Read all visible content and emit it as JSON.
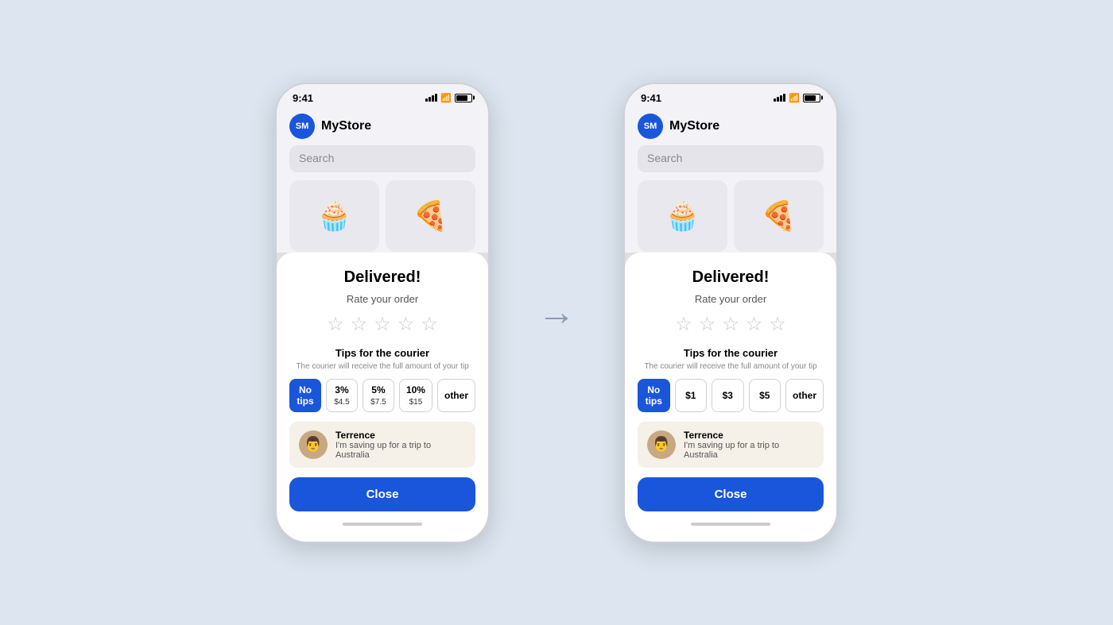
{
  "background": "#dde6f0",
  "phone_left": {
    "status_bar": {
      "time": "9:41"
    },
    "header": {
      "avatar_initials": "SM",
      "app_name": "MyStore"
    },
    "search": {
      "placeholder": "Search"
    },
    "products": [
      {
        "emoji": "🧁"
      },
      {
        "emoji": "🍕"
      }
    ],
    "modal": {
      "title": "Delivered!",
      "subtitle": "Rate your order",
      "stars": [
        "★",
        "★",
        "★",
        "★",
        "★"
      ],
      "tips_title": "Tips for the courier",
      "tips_subtitle": "The courier will receive the full amount of your tip",
      "tips": [
        {
          "label": "No tips",
          "value": "",
          "active": true
        },
        {
          "label": "3%",
          "value": "$4.5",
          "active": false
        },
        {
          "label": "5%",
          "value": "$7.5",
          "active": false
        },
        {
          "label": "10%",
          "value": "$15",
          "active": false
        },
        {
          "label": "other",
          "value": "",
          "active": false
        }
      ],
      "courier_name": "Terrence",
      "courier_message": "I'm saving up for a trip to Australia",
      "close_label": "Close"
    }
  },
  "phone_right": {
    "status_bar": {
      "time": "9:41"
    },
    "header": {
      "avatar_initials": "SM",
      "app_name": "MyStore"
    },
    "search": {
      "placeholder": "Search"
    },
    "products": [
      {
        "emoji": "🧁"
      },
      {
        "emoji": "🍕"
      }
    ],
    "modal": {
      "title": "Delivered!",
      "subtitle": "Rate your order",
      "stars": [
        "★",
        "★",
        "★",
        "★",
        "★"
      ],
      "tips_title": "Tips for the courier",
      "tips_subtitle": "The courier will receive the full amount of your tip",
      "tips": [
        {
          "label": "No tips",
          "value": "",
          "active": true
        },
        {
          "label": "$1",
          "value": "",
          "active": false
        },
        {
          "label": "$3",
          "value": "",
          "active": false
        },
        {
          "label": "$5",
          "value": "",
          "active": false
        },
        {
          "label": "other",
          "value": "",
          "active": false
        }
      ],
      "courier_name": "Terrence",
      "courier_message": "I'm saving up for a trip to Australia",
      "close_label": "Close"
    }
  },
  "arrow": "→"
}
